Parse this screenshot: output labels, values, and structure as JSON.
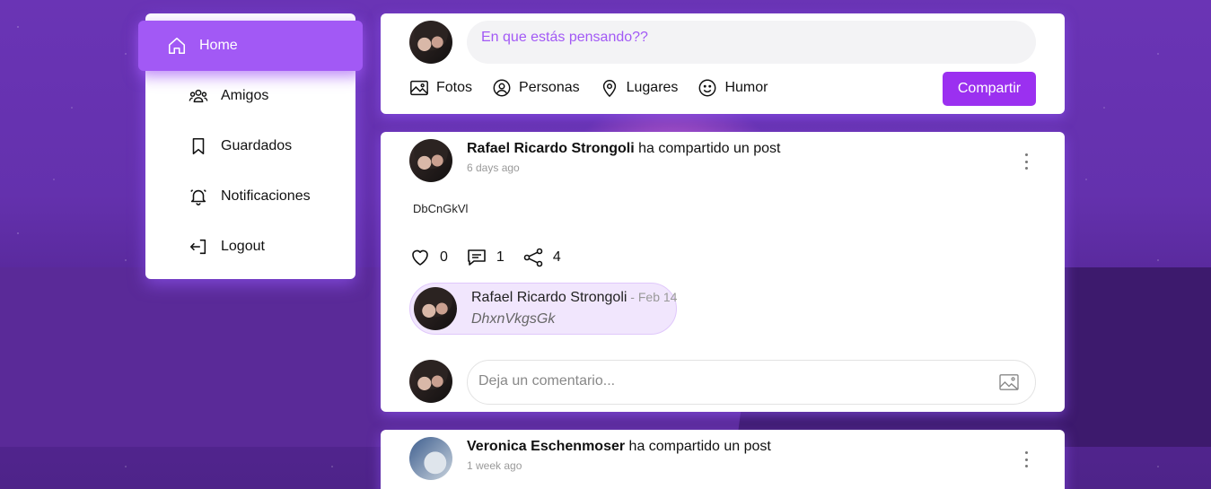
{
  "sidebar": {
    "items": [
      {
        "label": "Home",
        "icon": "home-icon",
        "active": true
      },
      {
        "label": "Amigos",
        "icon": "friends-icon"
      },
      {
        "label": "Guardados",
        "icon": "bookmark-icon"
      },
      {
        "label": "Notificaciones",
        "icon": "bell-icon"
      },
      {
        "label": "Logout",
        "icon": "logout-icon"
      }
    ]
  },
  "composer": {
    "placeholder": "En que estás pensando??",
    "options": [
      "Fotos",
      "Personas",
      "Lugares",
      "Humor"
    ],
    "share_label": "Compartir"
  },
  "posts": [
    {
      "author": "Rafael Ricardo Strongoli",
      "action": " ha compartido un post",
      "time": "6 days ago",
      "body": "DbCnGkVl",
      "likes": "0",
      "comments": "1",
      "shares": "4",
      "comment": {
        "author": "Rafael Ricardo Strongoli",
        "date": " - Feb 14",
        "text": "DhxnVkgsGk"
      },
      "comment_placeholder": "Deja un comentario..."
    },
    {
      "author": "Veronica Eschenmoser",
      "action": " ha compartido un post",
      "time": "1 week ago"
    }
  ],
  "colors": {
    "accent": "#a259f5",
    "button": "#9b30f0",
    "background": "#5b2aa0"
  }
}
